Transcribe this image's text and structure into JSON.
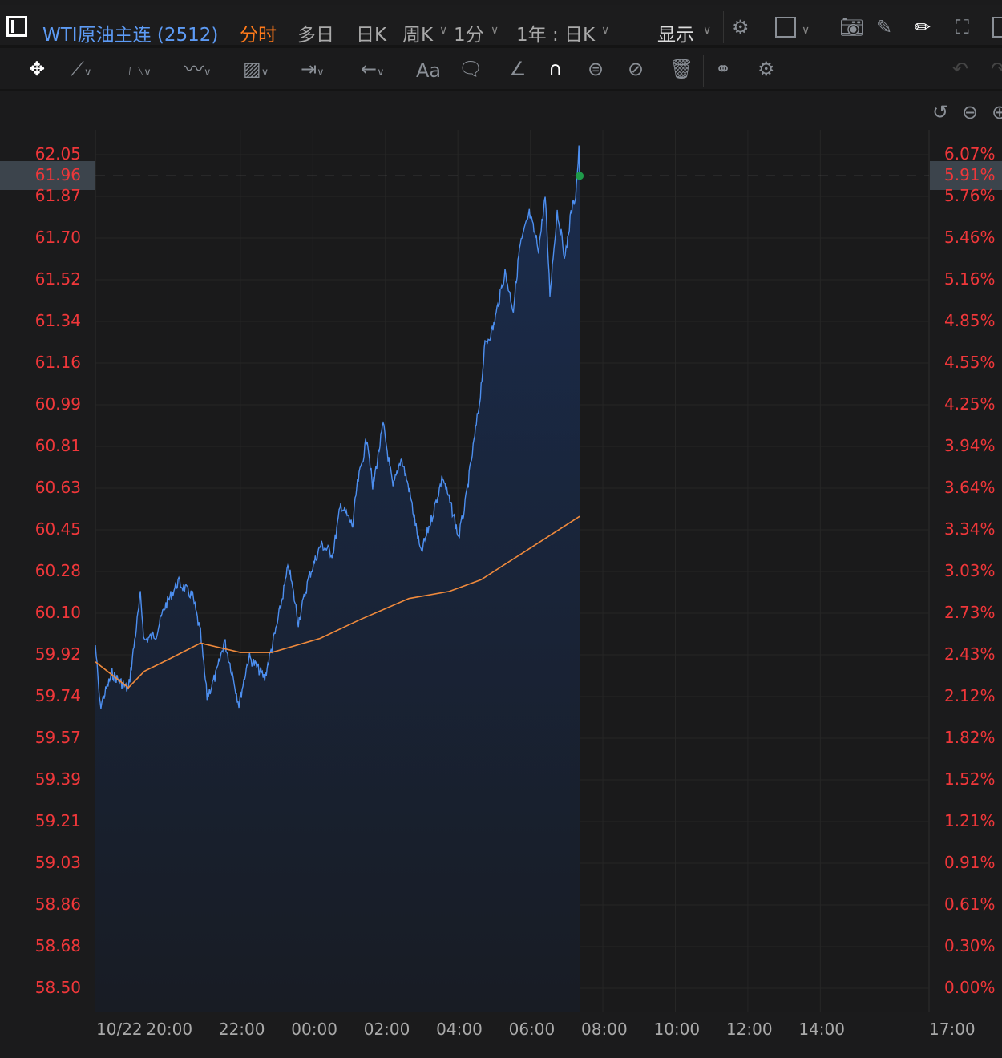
{
  "header": {
    "symbol": "WTI原油主连 (2512)",
    "tabs": [
      "分时",
      "多日",
      "日K",
      "周K",
      "1分",
      "1年 : 日K",
      "显示"
    ],
    "active_tab": "分时"
  },
  "toolbar": {
    "text_tool": "Aa"
  },
  "colors": {
    "accent": "#ff7a1a",
    "price_line": "#4d8ff0",
    "ma_line": "#f08a3c",
    "axis_text": "#f0373a"
  },
  "chart_data": {
    "type": "line",
    "current_price": "61.96",
    "current_pct": "5.91%",
    "ylim": [
      58.5,
      62.05
    ],
    "y_ticks": [
      "62.05",
      "61.96",
      "61.87",
      "61.70",
      "61.52",
      "61.34",
      "61.16",
      "60.99",
      "60.81",
      "60.63",
      "60.45",
      "60.28",
      "60.10",
      "59.92",
      "59.74",
      "59.57",
      "59.39",
      "59.21",
      "59.03",
      "58.86",
      "58.68",
      "58.50"
    ],
    "y_pct_ticks": [
      "6.07%",
      "5.91%",
      "5.76%",
      "5.46%",
      "5.16%",
      "4.85%",
      "4.55%",
      "4.25%",
      "3.94%",
      "3.64%",
      "3.34%",
      "3.03%",
      "2.73%",
      "2.43%",
      "2.12%",
      "1.82%",
      "1.52%",
      "1.21%",
      "0.91%",
      "0.61%",
      "0.30%",
      "0.00%"
    ],
    "x_ticks": [
      "10/22",
      "20:00",
      "22:00",
      "00:00",
      "02:00",
      "04:00",
      "06:00",
      "08:00",
      "10:00",
      "12:00",
      "14:00",
      "17:00"
    ],
    "x_range_hours": [
      0,
      23
    ],
    "series": [
      {
        "name": "price",
        "points": [
          [
            0,
            59.96
          ],
          [
            0.13,
            59.7
          ],
          [
            0.46,
            59.84
          ],
          [
            0.91,
            59.77
          ],
          [
            1.24,
            60.17
          ],
          [
            1.35,
            59.98
          ],
          [
            1.68,
            60.01
          ],
          [
            1.9,
            60.12
          ],
          [
            2.28,
            60.23
          ],
          [
            2.68,
            60.17
          ],
          [
            2.9,
            60.01
          ],
          [
            3.08,
            59.74
          ],
          [
            3.34,
            59.84
          ],
          [
            3.56,
            59.98
          ],
          [
            3.78,
            59.84
          ],
          [
            3.96,
            59.71
          ],
          [
            4.23,
            59.91
          ],
          [
            4.45,
            59.87
          ],
          [
            4.67,
            59.82
          ],
          [
            5.0,
            60.04
          ],
          [
            5.33,
            60.3
          ],
          [
            5.6,
            60.06
          ],
          [
            5.89,
            60.25
          ],
          [
            6.22,
            60.39
          ],
          [
            6.55,
            60.35
          ],
          [
            6.77,
            60.56
          ],
          [
            7.1,
            60.47
          ],
          [
            7.21,
            60.63
          ],
          [
            7.5,
            60.85
          ],
          [
            7.65,
            60.63
          ],
          [
            7.94,
            60.9
          ],
          [
            8.21,
            60.63
          ],
          [
            8.43,
            60.76
          ],
          [
            8.65,
            60.63
          ],
          [
            8.98,
            60.35
          ],
          [
            9.31,
            60.52
          ],
          [
            9.58,
            60.68
          ],
          [
            9.87,
            60.52
          ],
          [
            10.02,
            60.42
          ],
          [
            10.2,
            60.56
          ],
          [
            10.42,
            60.8
          ],
          [
            10.6,
            61.0
          ],
          [
            10.75,
            61.24
          ],
          [
            10.97,
            61.31
          ],
          [
            11.3,
            61.55
          ],
          [
            11.53,
            61.39
          ],
          [
            11.7,
            61.65
          ],
          [
            11.97,
            61.8
          ],
          [
            12.23,
            61.65
          ],
          [
            12.41,
            61.87
          ],
          [
            12.54,
            61.46
          ],
          [
            12.74,
            61.81
          ],
          [
            12.96,
            61.61
          ],
          [
            13.12,
            61.8
          ],
          [
            13.25,
            61.88
          ],
          [
            13.34,
            62.07
          ],
          [
            13.36,
            61.96
          ]
        ]
      },
      {
        "name": "avg",
        "points": [
          [
            0,
            59.89
          ],
          [
            0.91,
            59.78
          ],
          [
            1.35,
            59.85
          ],
          [
            2.01,
            59.9
          ],
          [
            2.9,
            59.97
          ],
          [
            4.0,
            59.93
          ],
          [
            4.87,
            59.93
          ],
          [
            6.2,
            59.99
          ],
          [
            7.3,
            60.07
          ],
          [
            8.65,
            60.16
          ],
          [
            9.76,
            60.19
          ],
          [
            10.64,
            60.24
          ],
          [
            11.75,
            60.35
          ],
          [
            13.36,
            60.51
          ]
        ]
      }
    ]
  }
}
